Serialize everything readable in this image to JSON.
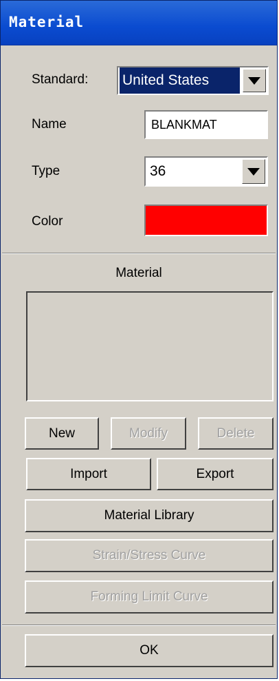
{
  "window": {
    "title": "Material"
  },
  "fields": {
    "standard": {
      "label": "Standard:",
      "value": "United States"
    },
    "name": {
      "label": "Name",
      "value": "BLANKMAT"
    },
    "type": {
      "label": "Type",
      "value": "36"
    },
    "color": {
      "label": "Color",
      "value_hex": "#ff0000"
    }
  },
  "material_section": {
    "label": "Material",
    "items": []
  },
  "buttons": {
    "new": "New",
    "modify": "Modify",
    "delete": "Delete",
    "import": "Import",
    "export": "Export",
    "material_library": "Material Library",
    "strain_stress_curve": "Strain/Stress Curve",
    "forming_limit_curve": "Forming Limit Curve",
    "ok": "OK"
  },
  "button_states": {
    "modify": "disabled",
    "delete": "disabled",
    "strain_stress_curve": "disabled",
    "forming_limit_curve": "disabled"
  },
  "colors": {
    "title_bar": "#0a4bd0",
    "dialog_bg": "#d4d0c8",
    "selection": "#0a246a",
    "color_swatch": "#ff0000"
  }
}
